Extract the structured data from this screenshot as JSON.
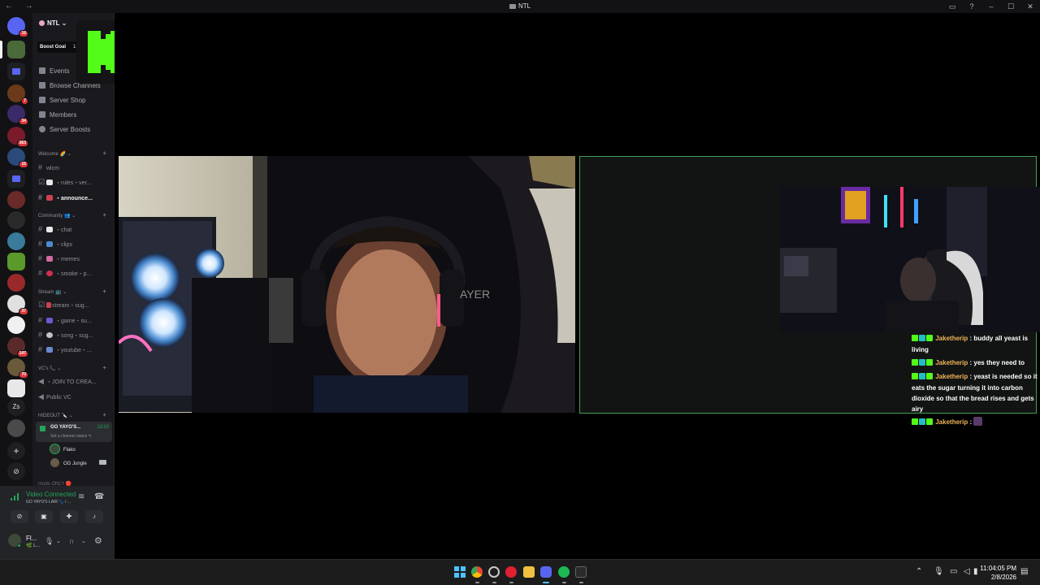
{
  "window": {
    "title": "NTL",
    "nav_arrows": "← →",
    "buttons": {
      "inbox": "▭",
      "help": "?",
      "minimize": "–",
      "maximize": "☐",
      "close": "✕"
    }
  },
  "rail": {
    "badges": [
      "16",
      "7",
      "34",
      "363",
      "15",
      "37",
      "147",
      "70"
    ],
    "text_server": "Zs",
    "add_label": "+",
    "discover_label": "⊘"
  },
  "sidebar": {
    "server_name": "NTL",
    "boost_goal": "Boost Goal",
    "boost_count": "1",
    "nav": {
      "events": "Events",
      "browse": "Browse Channels",
      "shop": "Server Shop",
      "members": "Members",
      "boosts": "Server Boosts"
    },
    "categories": {
      "welcome": "Welcome 🌈 ⌄",
      "community": "Community 👥 ⌄",
      "stream": "Stream 📺 ⌄",
      "vcs": "VC's 📞 ⌄",
      "hideout": "HIDEOUT 🔪 ⌄",
      "mods": "mods ONLY 🔴"
    },
    "channels": {
      "wlcm": "wlcm",
      "rules": "・rules・ver...",
      "announce": "・announce...",
      "chat": "・chat",
      "clips": "・clips",
      "memes": "・memes",
      "smoke": "・smoke・p...",
      "stream_sug": "stream・sug...",
      "game_su": "・game・su...",
      "song_sug": "・song・sug...",
      "youtube": "・youtube・...",
      "join": "・JOIN TO CREA...",
      "public_vc": "Public VC"
    },
    "active_vc": {
      "name": "GO YAYO'S...",
      "count": "11/10",
      "status": "Set a channel status ✎"
    },
    "vc_users": [
      "Flako",
      "OG Jungle"
    ]
  },
  "voice_panel": {
    "connected": "Video Connected",
    "channel": "GO YAYO'S LAIR 🐾 / ..."
  },
  "user_panel": {
    "name": "Fl...",
    "status": "🌿 L..."
  },
  "chat": [
    {
      "user": "Jaketherip",
      "text": " : buddy all yeast is living"
    },
    {
      "user": "Jaketherip",
      "text": " : yes they need to"
    },
    {
      "user": "Jaketherip",
      "text": " : yeast is needed so it eats the sugar turning it into carbon dioxide so that the bread rises and gets airy"
    },
    {
      "user": "Jaketherip",
      "text": " : "
    }
  ],
  "clock": {
    "time": "11:04:05 PM",
    "date": "2/8/2026"
  },
  "colors": {
    "kick_green": "#53fc18",
    "discord_green": "#23a55a",
    "chat_username": "#f0b45a",
    "badge_red": "#da373c"
  }
}
